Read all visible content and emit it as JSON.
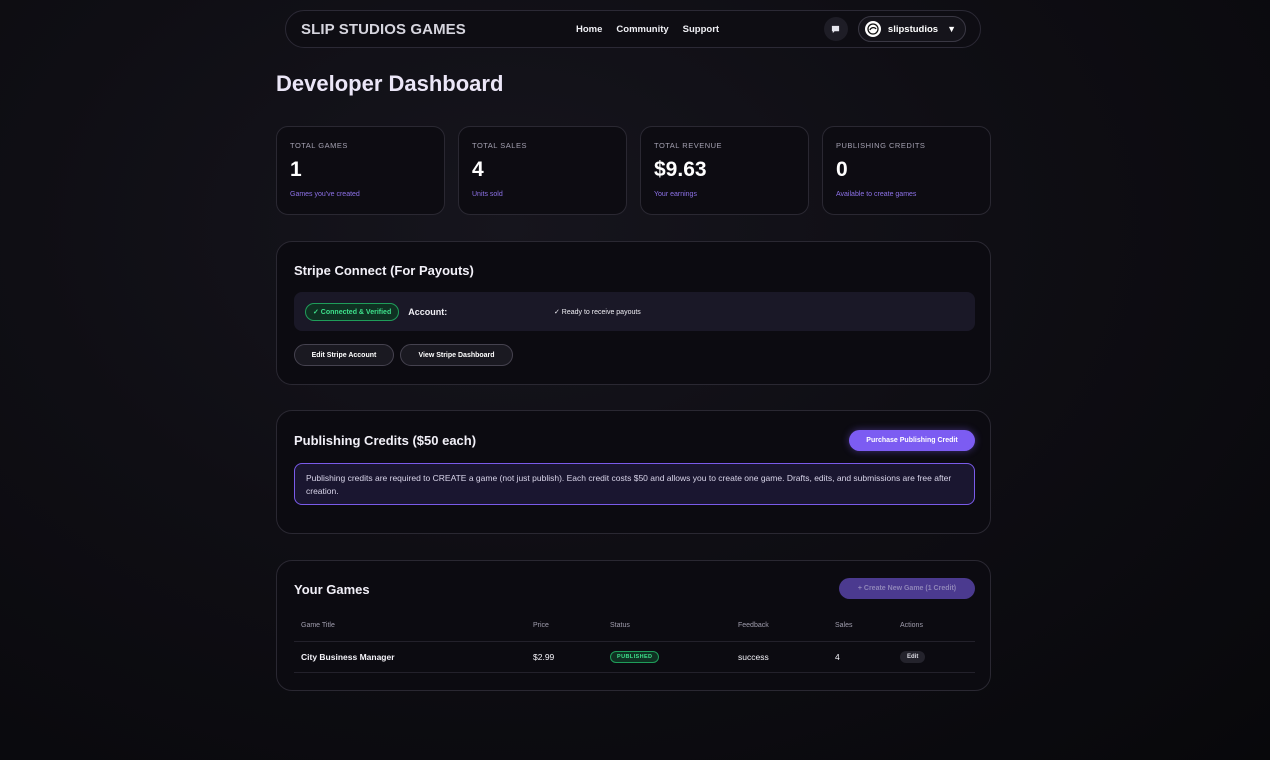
{
  "nav": {
    "brand": "SLIP STUDIOS GAMES",
    "links": [
      "Home",
      "Community",
      "Support"
    ],
    "username": "slipstudios",
    "icons": {
      "chat": "chat-icon",
      "avatar": "user-avatar-icon",
      "caret": "caret-down-icon"
    }
  },
  "page": {
    "title": "Developer Dashboard"
  },
  "stats": [
    {
      "label": "TOTAL GAMES",
      "value": "1",
      "sub": "Games you've created"
    },
    {
      "label": "TOTAL SALES",
      "value": "4",
      "sub": "Units sold"
    },
    {
      "label": "TOTAL REVENUE",
      "value": "$9.63",
      "sub": "Your earnings"
    },
    {
      "label": "PUBLISHING CREDITS",
      "value": "0",
      "sub": "Available to create games"
    }
  ],
  "stripe": {
    "title": "Stripe Connect (For Payouts)",
    "badge": "✓ Connected & Verified",
    "account_label": "Account:",
    "status": "✓ Ready to receive payouts",
    "edit_button": "Edit Stripe Account",
    "view_button": "View Stripe Dashboard"
  },
  "credits": {
    "title": "Publishing Credits ($50 each)",
    "purchase_button": "Purchase Publishing Credit",
    "info": "Publishing credits are required to CREATE a game (not just publish). Each credit costs $50 and allows you to create one game. Drafts, edits, and submissions are free after creation."
  },
  "games": {
    "title": "Your Games",
    "create_button": "+ Create New Game (1 Credit)",
    "columns": [
      "Game Title",
      "Price",
      "Status",
      "Feedback",
      "Sales",
      "Actions"
    ],
    "rows": [
      {
        "title": "City Business Manager",
        "price": "$2.99",
        "status": "PUBLISHED",
        "feedback": "success",
        "sales": "4",
        "action": "Edit"
      }
    ]
  },
  "colors": {
    "accent": "#7c5cf2",
    "success": "#3ee08b",
    "background": "#0f0e14"
  }
}
